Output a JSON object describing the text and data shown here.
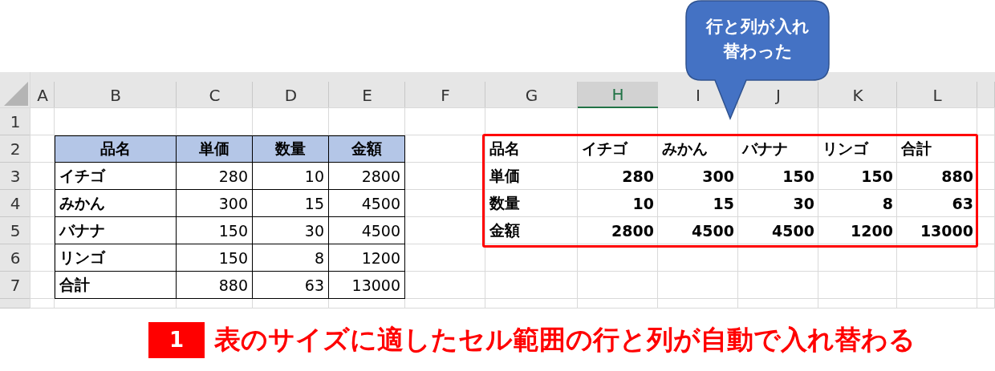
{
  "callout": {
    "text": "行と列が入れ替わった"
  },
  "sheet": {
    "columns": [
      {
        "label": "A",
        "selected": false
      },
      {
        "label": "B",
        "selected": false
      },
      {
        "label": "C",
        "selected": false
      },
      {
        "label": "D",
        "selected": false
      },
      {
        "label": "E",
        "selected": false
      },
      {
        "label": "F",
        "selected": false
      },
      {
        "label": "G",
        "selected": false
      },
      {
        "label": "H",
        "selected": true
      },
      {
        "label": "I",
        "selected": false
      },
      {
        "label": "J",
        "selected": false
      },
      {
        "label": "K",
        "selected": false
      },
      {
        "label": "L",
        "selected": false
      }
    ],
    "rows": [
      "1",
      "2",
      "3",
      "4",
      "5",
      "6",
      "7"
    ],
    "source_table": {
      "columns": [
        "品名",
        "単価",
        "数量",
        "金額"
      ],
      "rows": [
        [
          "イチゴ",
          "280",
          "10",
          "2800"
        ],
        [
          "みかん",
          "300",
          "15",
          "4500"
        ],
        [
          "バナナ",
          "150",
          "30",
          "4500"
        ],
        [
          "リンゴ",
          "150",
          "8",
          "1200"
        ],
        [
          "合計",
          "880",
          "63",
          "13000"
        ]
      ]
    },
    "result_table": {
      "rows": [
        [
          "品名",
          "イチゴ",
          "みかん",
          "バナナ",
          "リンゴ",
          "合計"
        ],
        [
          "単価",
          "280",
          "300",
          "150",
          "150",
          "880"
        ],
        [
          "数量",
          "10",
          "15",
          "30",
          "8",
          "63"
        ],
        [
          "金額",
          "2800",
          "4500",
          "4500",
          "1200",
          "13000"
        ]
      ]
    }
  },
  "caption": {
    "step": "1",
    "text": "表のサイズに適したセル範囲の行と列が自動で入れ替わる"
  }
}
